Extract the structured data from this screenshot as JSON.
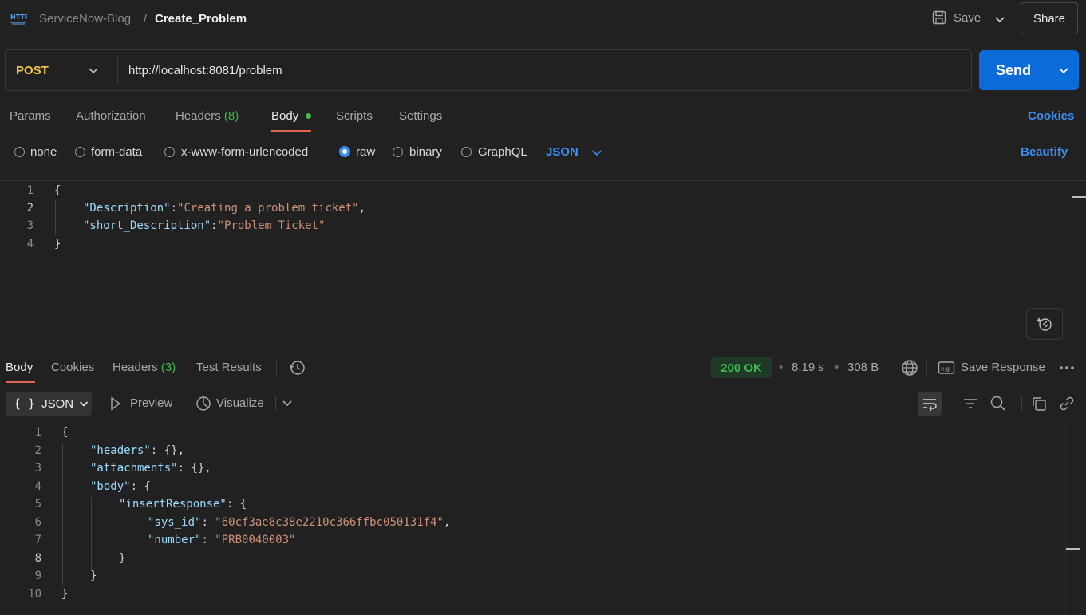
{
  "header": {
    "protocol_icon": "http-icon",
    "workspace": "ServiceNow-Blog",
    "separator": "/",
    "request_name": "Create_Problem",
    "save_label": "Save",
    "share_label": "Share"
  },
  "request": {
    "method": "POST",
    "url": "http://localhost:8081/problem",
    "send_label": "Send"
  },
  "request_tabs": {
    "params": "Params",
    "authorization": "Authorization",
    "headers": "Headers",
    "headers_count": "(8)",
    "body": "Body",
    "scripts": "Scripts",
    "settings": "Settings",
    "cookies": "Cookies"
  },
  "body_types": {
    "none": "none",
    "form_data": "form-data",
    "urlencoded": "x-www-form-urlencoded",
    "raw": "raw",
    "binary": "binary",
    "graphql": "GraphQL",
    "format": "JSON",
    "beautify": "Beautify",
    "selected": "raw"
  },
  "request_body": {
    "line_numbers": [
      "1",
      "2",
      "3",
      "4"
    ],
    "open_brace": "{",
    "close_brace": "}",
    "key1": "\"Description\"",
    "colon": ":",
    "val1": "\"Creating a problem ticket\"",
    "comma": ",",
    "key2": "\"short_Description\"",
    "val2": "\"Problem Ticket\""
  },
  "response_tabs": {
    "body": "Body",
    "cookies": "Cookies",
    "headers": "Headers",
    "headers_count": "(3)",
    "test_results": "Test Results"
  },
  "response_meta": {
    "status": "200 OK",
    "time": "8.19 s",
    "size": "308 B",
    "save_response": "Save Response",
    "dot": "•"
  },
  "response_toolbar": {
    "json_label": "JSON",
    "json_braces": "{ }",
    "preview": "Preview",
    "visualize": "Visualize"
  },
  "response_body": {
    "line_numbers": [
      "1",
      "2",
      "3",
      "4",
      "5",
      "6",
      "7",
      "8",
      "9",
      "10"
    ],
    "open_brace": "{",
    "close_brace": "}",
    "headers_key": "\"headers\"",
    "attachments_key": "\"attachments\"",
    "body_key": "\"body\"",
    "insert_key": "\"insertResponse\"",
    "sys_id_key": "\"sys_id\"",
    "sys_id_val": "\"60cf3ae8c38e2210c366ffbc050131f4\"",
    "number_key": "\"number\"",
    "number_val": "\"PRB0040003\"",
    "empty_obj": "{}",
    "colon_space": ": ",
    "comma": ","
  },
  "colors": {
    "accent": "#0b6bd8",
    "method": "#f2c94c",
    "status_ok": "#3fb950",
    "json_key": "#9cdcfe",
    "json_string": "#ce9178"
  }
}
